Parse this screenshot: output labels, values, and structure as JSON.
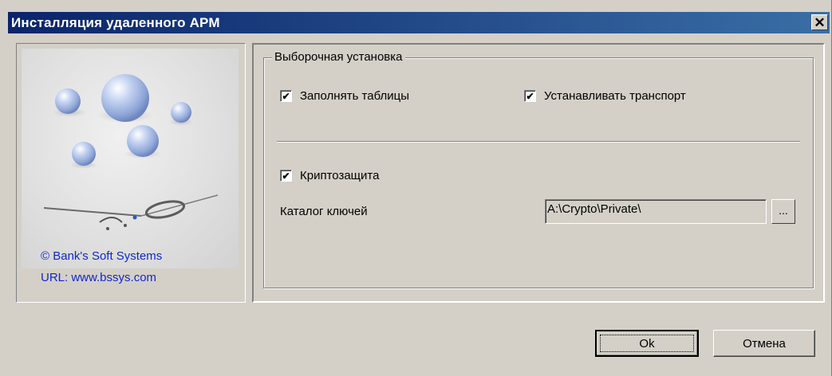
{
  "window": {
    "title": "Инсталляция удаленного АРМ",
    "close_glyph": "✕"
  },
  "branding": {
    "copyright": "© Bank's Soft Systems",
    "url": "URL: www.bssys.com"
  },
  "group": {
    "title": "Выборочная установка",
    "fill_tables": {
      "label": "Заполнять таблицы",
      "checked": true
    },
    "install_transport": {
      "label": "Устанавливать транспорт",
      "checked": true
    },
    "crypto": {
      "label": "Криптозащита",
      "checked": true
    },
    "key_dir": {
      "label": "Каталог ключей",
      "value": "A:\\Crypto\\Private\\",
      "browse_label": "..."
    }
  },
  "buttons": {
    "ok": "Ok",
    "cancel": "Отмена"
  },
  "check_glyph": "✔"
}
